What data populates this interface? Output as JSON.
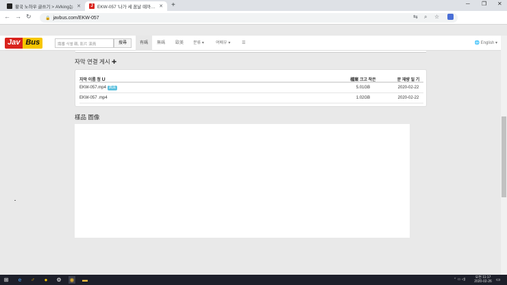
{
  "browser": {
    "tabs": [
      {
        "title": "황국 노하우 글쓰기 > AVking는"
      },
      {
        "title": "EKW-057 '나가 세 꿈날 때까지 '"
      }
    ],
    "url": "javbus.com/EKW-057"
  },
  "site": {
    "logo_part1": "Jav",
    "logo_part2": "Bus",
    "search_placeholder": "識番 식별 碼, 影片 演員",
    "search_button": "搜尋",
    "nav": [
      "有碼",
      "無碼",
      "歐美",
      "분류 ▾",
      "여배우 ▾",
      "☰"
    ],
    "language": "English"
  },
  "magnets": {
    "section_title": "자막 연결 게시",
    "header": {
      "name": "자막 이름 청",
      "size": "檔案 크고 작은",
      "date": "분 재량 일 기"
    },
    "rows": [
      {
        "name": "EKW-057.mp4",
        "tag": "高清",
        "size": "5.01GB",
        "date": "2020-02-22"
      },
      {
        "name": "EKW-057 .mp4",
        "tag": "",
        "size": "1.02GB",
        "date": "2020-02-22"
      }
    ]
  },
  "samples": {
    "section_title": "樣品 圖像"
  },
  "taskbar": {
    "time": "오전 11:17",
    "date": "2020-02-26"
  }
}
